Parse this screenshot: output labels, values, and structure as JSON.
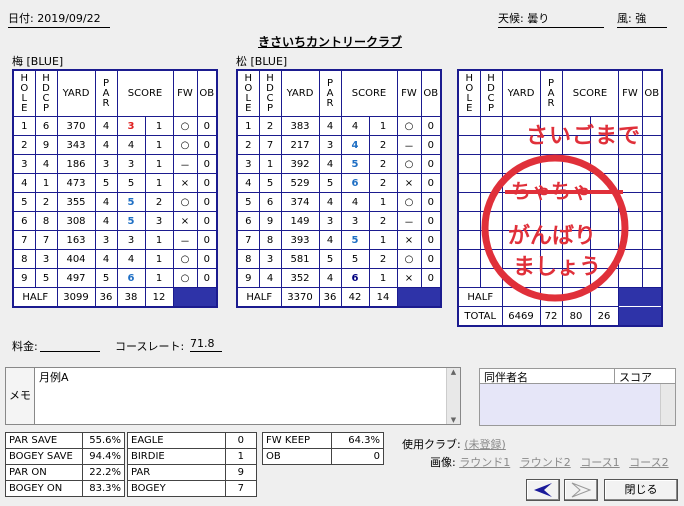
{
  "header": {
    "date_label": "日付: 2019/09/22",
    "weather_label": "天候: 曇り",
    "wind_label": "風: 強",
    "course_name": "きさいちカントリークラブ"
  },
  "cards": [
    {
      "title": "梅 [BLUE]",
      "headers": [
        "HOLE",
        "HDCP",
        "YARD",
        "PAR",
        "SCORE",
        "FW",
        "OB"
      ],
      "rows": [
        {
          "hole": "1",
          "hdcp": "6",
          "yard": "370",
          "par": "4",
          "score": "3",
          "putt": "1",
          "fw": "○",
          "ob": "0",
          "tone": "red"
        },
        {
          "hole": "2",
          "hdcp": "9",
          "yard": "343",
          "par": "4",
          "score": "4",
          "putt": "1",
          "fw": "○",
          "ob": "0",
          "tone": ""
        },
        {
          "hole": "3",
          "hdcp": "4",
          "yard": "186",
          "par": "3",
          "score": "3",
          "putt": "1",
          "fw": "－",
          "ob": "0",
          "tone": ""
        },
        {
          "hole": "4",
          "hdcp": "1",
          "yard": "473",
          "par": "5",
          "score": "5",
          "putt": "1",
          "fw": "×",
          "ob": "0",
          "tone": ""
        },
        {
          "hole": "5",
          "hdcp": "2",
          "yard": "355",
          "par": "4",
          "score": "5",
          "putt": "2",
          "fw": "○",
          "ob": "0",
          "tone": "blue"
        },
        {
          "hole": "6",
          "hdcp": "8",
          "yard": "308",
          "par": "4",
          "score": "5",
          "putt": "3",
          "fw": "×",
          "ob": "0",
          "tone": "blue"
        },
        {
          "hole": "7",
          "hdcp": "7",
          "yard": "163",
          "par": "3",
          "score": "3",
          "putt": "1",
          "fw": "－",
          "ob": "0",
          "tone": ""
        },
        {
          "hole": "8",
          "hdcp": "3",
          "yard": "404",
          "par": "4",
          "score": "4",
          "putt": "1",
          "fw": "○",
          "ob": "0",
          "tone": ""
        },
        {
          "hole": "9",
          "hdcp": "5",
          "yard": "497",
          "par": "5",
          "score": "6",
          "putt": "1",
          "fw": "○",
          "ob": "0",
          "tone": "blue"
        }
      ],
      "half": {
        "label": "HALF",
        "yard": "3099",
        "par": "36",
        "score": "38",
        "putt": "12"
      }
    },
    {
      "title": "松 [BLUE]",
      "headers": [
        "HOLE",
        "HDCP",
        "YARD",
        "PAR",
        "SCORE",
        "FW",
        "OB"
      ],
      "rows": [
        {
          "hole": "1",
          "hdcp": "2",
          "yard": "383",
          "par": "4",
          "score": "4",
          "putt": "1",
          "fw": "○",
          "ob": "0",
          "tone": ""
        },
        {
          "hole": "2",
          "hdcp": "7",
          "yard": "217",
          "par": "3",
          "score": "4",
          "putt": "2",
          "fw": "－",
          "ob": "0",
          "tone": "blue"
        },
        {
          "hole": "3",
          "hdcp": "1",
          "yard": "392",
          "par": "4",
          "score": "5",
          "putt": "2",
          "fw": "○",
          "ob": "0",
          "tone": "blue"
        },
        {
          "hole": "4",
          "hdcp": "5",
          "yard": "529",
          "par": "5",
          "score": "6",
          "putt": "2",
          "fw": "×",
          "ob": "0",
          "tone": "blue"
        },
        {
          "hole": "5",
          "hdcp": "6",
          "yard": "374",
          "par": "4",
          "score": "4",
          "putt": "1",
          "fw": "○",
          "ob": "0",
          "tone": ""
        },
        {
          "hole": "6",
          "hdcp": "9",
          "yard": "149",
          "par": "3",
          "score": "3",
          "putt": "2",
          "fw": "－",
          "ob": "0",
          "tone": ""
        },
        {
          "hole": "7",
          "hdcp": "8",
          "yard": "393",
          "par": "4",
          "score": "5",
          "putt": "1",
          "fw": "×",
          "ob": "0",
          "tone": "blue"
        },
        {
          "hole": "8",
          "hdcp": "3",
          "yard": "581",
          "par": "5",
          "score": "5",
          "putt": "2",
          "fw": "○",
          "ob": "0",
          "tone": ""
        },
        {
          "hole": "9",
          "hdcp": "4",
          "yard": "352",
          "par": "4",
          "score": "6",
          "putt": "1",
          "fw": "×",
          "ob": "0",
          "tone": "navy"
        }
      ],
      "half": {
        "label": "HALF",
        "yard": "3370",
        "par": "36",
        "score": "42",
        "putt": "14"
      }
    }
  ],
  "third_card": {
    "headers": [
      "HOLE",
      "HDCP",
      "YARD",
      "PAR",
      "SCORE",
      "FW",
      "OB"
    ],
    "half_label": "HALF",
    "total": {
      "label": "TOTAL",
      "yard": "6469",
      "par": "72",
      "score": "80",
      "putt": "26"
    }
  },
  "stamp": {
    "top_text": "さいごまで",
    "struck_text": "ちゃちゃ",
    "line1": "がんばり",
    "line2": "ましょう",
    "color": "#e0303a"
  },
  "fee": {
    "label": "料金:",
    "value": ""
  },
  "course_rate": {
    "label": "コースレート:",
    "value": "71.8"
  },
  "memo": {
    "label": "メモ",
    "value": "月例A"
  },
  "companions": {
    "col_name": "同伴者名",
    "col_score": "スコア"
  },
  "stats": {
    "left": [
      {
        "label": "PAR SAVE",
        "value": "55.6%"
      },
      {
        "label": "BOGEY SAVE",
        "value": "94.4%"
      },
      {
        "label": "PAR ON",
        "value": "22.2%"
      },
      {
        "label": "BOGEY ON",
        "value": "83.3%"
      }
    ],
    "mid": [
      {
        "label": "EAGLE",
        "value": "0"
      },
      {
        "label": "BIRDIE",
        "value": "1"
      },
      {
        "label": "PAR",
        "value": "9"
      },
      {
        "label": "BOGEY",
        "value": "7"
      }
    ],
    "right": [
      {
        "label": "FW KEEP",
        "value": "64.3%"
      },
      {
        "label": "OB",
        "value": "0"
      }
    ]
  },
  "club": {
    "label": "使用クラブ:",
    "value": "(未登録)"
  },
  "image": {
    "label": "画像:",
    "links": [
      "ラウンド1",
      "ラウンド2",
      "コース1",
      "コース2"
    ]
  },
  "buttons": {
    "close": "閉じる"
  },
  "colors": {
    "accent": "#2e33a8",
    "border": "#1b1b8f",
    "stamp": "#e0303a"
  }
}
